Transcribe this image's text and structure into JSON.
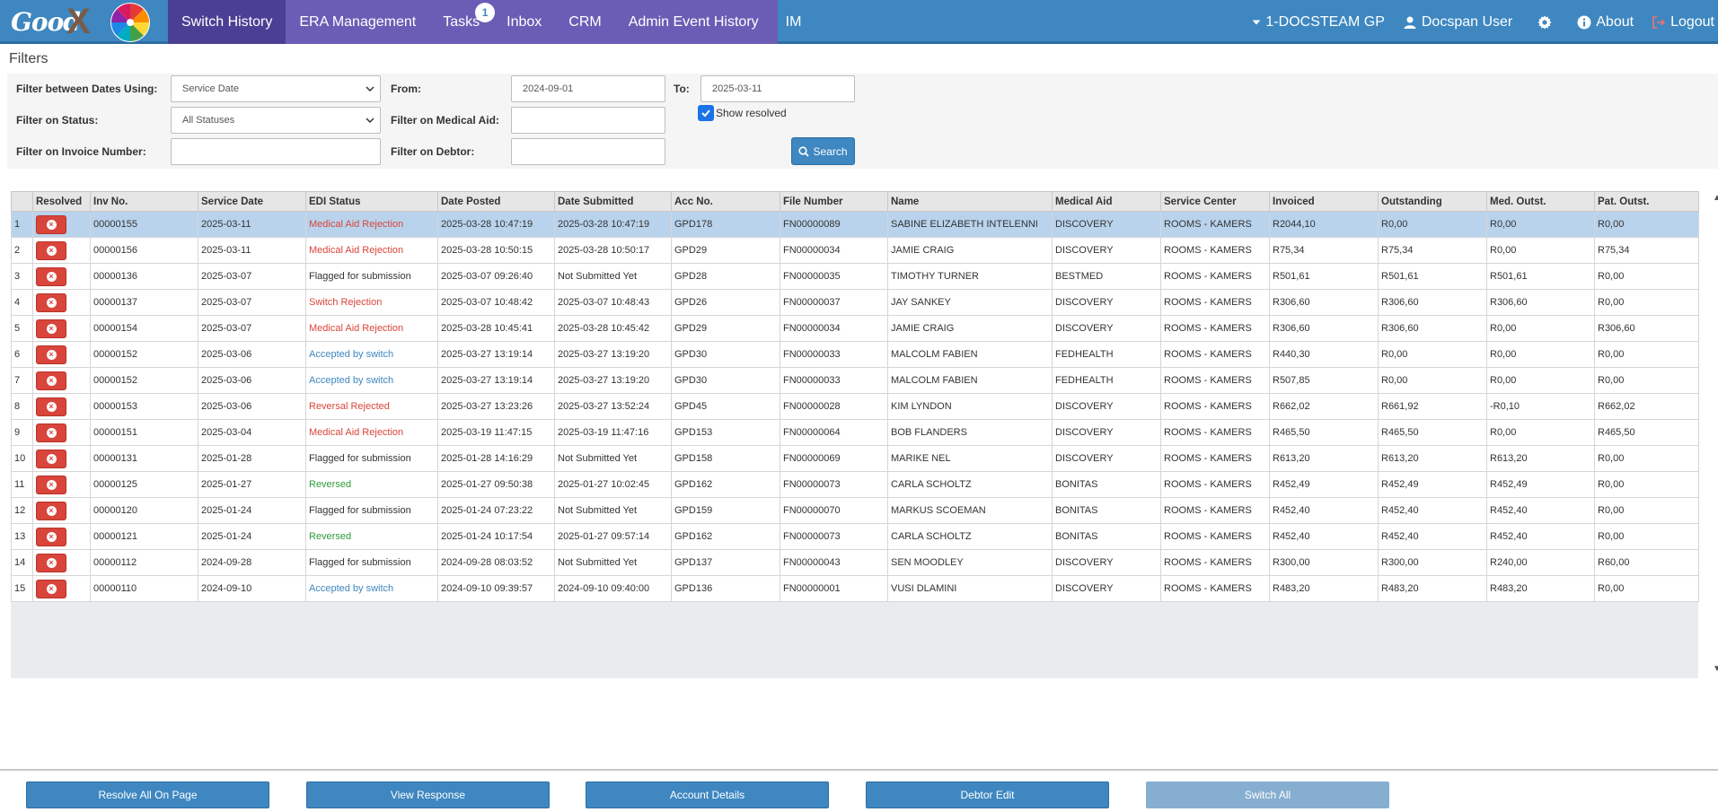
{
  "app": {
    "logo_text": "Good",
    "logo_x": "X"
  },
  "nav": {
    "items": [
      {
        "label": "Switch History",
        "active": true
      },
      {
        "label": "ERA Management"
      },
      {
        "label": "Tasks",
        "badge": "1"
      },
      {
        "label": "Inbox"
      },
      {
        "label": "CRM"
      },
      {
        "label": "Admin Event History"
      },
      {
        "label": "IM"
      }
    ],
    "right": {
      "practice": "1-DOCSTEAM GP",
      "user": "Docspan User",
      "about": "About",
      "logout": "Logout"
    }
  },
  "filters": {
    "title": "Filters",
    "dates_label": "Filter between Dates Using:",
    "dates_value": "Service Date",
    "from_label": "From:",
    "from_value": "2024-09-01",
    "to_label": "To:",
    "to_value": "2025-03-11",
    "status_label": "Filter on Status:",
    "status_value": "All Statuses",
    "medaid_label": "Filter on Medical Aid:",
    "medaid_value": "",
    "show_resolved_label": "Show resolved",
    "show_resolved": true,
    "invoice_label": "Filter on Invoice Number:",
    "invoice_value": "",
    "debtor_label": "Filter on Debtor:",
    "debtor_value": "",
    "search_label": "Search"
  },
  "table": {
    "columns": [
      "",
      "Resolved",
      "Inv No.",
      "Service Date",
      "EDI Status",
      "Date Posted",
      "Date Submitted",
      "Acc No.",
      "File Number",
      "Name",
      "Medical Aid",
      "Service Center",
      "Invoiced",
      "Outstanding",
      "Med. Outst.",
      "Pat. Outst."
    ],
    "rows": [
      {
        "n": "1",
        "inv": "00000155",
        "sdate": "2025-03-11",
        "status": "Medical Aid Rejection",
        "stype": "red",
        "posted": "2025-03-28 10:47:19",
        "submitted": "2025-03-28 10:47:19",
        "acc": "GPD178",
        "file": "FN00000089",
        "name": "SABINE ELIZABETH INTELENNI",
        "medaid": "DISCOVERY",
        "center": "ROOMS - KAMERS",
        "invoiced": "R2044,10",
        "outstanding": "R0,00",
        "med": "R0,00",
        "pat": "R0,00",
        "selected": true
      },
      {
        "n": "2",
        "inv": "00000156",
        "sdate": "2025-03-11",
        "status": "Medical Aid Rejection",
        "stype": "red",
        "posted": "2025-03-28 10:50:15",
        "submitted": "2025-03-28 10:50:17",
        "acc": "GPD29",
        "file": "FN00000034",
        "name": "JAMIE CRAIG",
        "medaid": "DISCOVERY",
        "center": "ROOMS - KAMERS",
        "invoiced": "R75,34",
        "outstanding": "R75,34",
        "med": "R0,00",
        "pat": "R75,34"
      },
      {
        "n": "3",
        "inv": "00000136",
        "sdate": "2025-03-07",
        "status": "Flagged for submission",
        "stype": "normal",
        "posted": "2025-03-07 09:26:40",
        "submitted": "Not Submitted Yet",
        "acc": "GPD28",
        "file": "FN00000035",
        "name": "TIMOTHY TURNER",
        "medaid": "BESTMED",
        "center": "ROOMS - KAMERS",
        "invoiced": "R501,61",
        "outstanding": "R501,61",
        "med": "R501,61",
        "pat": "R0,00"
      },
      {
        "n": "4",
        "inv": "00000137",
        "sdate": "2025-03-07",
        "status": "Switch Rejection",
        "stype": "red",
        "posted": "2025-03-07 10:48:42",
        "submitted": "2025-03-07 10:48:43",
        "acc": "GPD26",
        "file": "FN00000037",
        "name": "JAY SANKEY",
        "medaid": "DISCOVERY",
        "center": "ROOMS - KAMERS",
        "invoiced": "R306,60",
        "outstanding": "R306,60",
        "med": "R306,60",
        "pat": "R0,00"
      },
      {
        "n": "5",
        "inv": "00000154",
        "sdate": "2025-03-07",
        "status": "Medical Aid Rejection",
        "stype": "red",
        "posted": "2025-03-28 10:45:41",
        "submitted": "2025-03-28 10:45:42",
        "acc": "GPD29",
        "file": "FN00000034",
        "name": "JAMIE CRAIG",
        "medaid": "DISCOVERY",
        "center": "ROOMS - KAMERS",
        "invoiced": "R306,60",
        "outstanding": "R306,60",
        "med": "R0,00",
        "pat": "R306,60"
      },
      {
        "n": "6",
        "inv": "00000152",
        "sdate": "2025-03-06",
        "status": "Accepted by switch",
        "stype": "blue",
        "posted": "2025-03-27 13:19:14",
        "submitted": "2025-03-27 13:19:20",
        "acc": "GPD30",
        "file": "FN00000033",
        "name": "MALCOLM FABIEN",
        "medaid": "FEDHEALTH",
        "center": "ROOMS - KAMERS",
        "invoiced": "R440,30",
        "outstanding": "R0,00",
        "med": "R0,00",
        "pat": "R0,00"
      },
      {
        "n": "7",
        "inv": "00000152",
        "sdate": "2025-03-06",
        "status": "Accepted by switch",
        "stype": "blue",
        "posted": "2025-03-27 13:19:14",
        "submitted": "2025-03-27 13:19:20",
        "acc": "GPD30",
        "file": "FN00000033",
        "name": "MALCOLM FABIEN",
        "medaid": "FEDHEALTH",
        "center": "ROOMS - KAMERS",
        "invoiced": "R507,85",
        "outstanding": "R0,00",
        "med": "R0,00",
        "pat": "R0,00"
      },
      {
        "n": "8",
        "inv": "00000153",
        "sdate": "2025-03-06",
        "status": "Reversal Rejected",
        "stype": "red",
        "posted": "2025-03-27 13:23:26",
        "submitted": "2025-03-27 13:52:24",
        "acc": "GPD45",
        "file": "FN00000028",
        "name": "KIM LYNDON",
        "medaid": "DISCOVERY",
        "center": "ROOMS - KAMERS",
        "invoiced": "R662,02",
        "outstanding": "R661,92",
        "med": "-R0,10",
        "pat": "R662,02"
      },
      {
        "n": "9",
        "inv": "00000151",
        "sdate": "2025-03-04",
        "status": "Medical Aid Rejection",
        "stype": "red",
        "posted": "2025-03-19 11:47:15",
        "submitted": "2025-03-19 11:47:16",
        "acc": "GPD153",
        "file": "FN00000064",
        "name": "BOB FLANDERS",
        "medaid": "DISCOVERY",
        "center": "ROOMS - KAMERS",
        "invoiced": "R465,50",
        "outstanding": "R465,50",
        "med": "R0,00",
        "pat": "R465,50"
      },
      {
        "n": "10",
        "inv": "00000131",
        "sdate": "2025-01-28",
        "status": "Flagged for submission",
        "stype": "normal",
        "posted": "2025-01-28 14:16:29",
        "submitted": "Not Submitted Yet",
        "acc": "GPD158",
        "file": "FN00000069",
        "name": "MARIKE NEL",
        "medaid": "DISCOVERY",
        "center": "ROOMS - KAMERS",
        "invoiced": "R613,20",
        "outstanding": "R613,20",
        "med": "R613,20",
        "pat": "R0,00"
      },
      {
        "n": "11",
        "inv": "00000125",
        "sdate": "2025-01-27",
        "status": "Reversed",
        "stype": "green",
        "posted": "2025-01-27 09:50:38",
        "submitted": "2025-01-27 10:02:45",
        "acc": "GPD162",
        "file": "FN00000073",
        "name": "CARLA SCHOLTZ",
        "medaid": "BONITAS",
        "center": "ROOMS - KAMERS",
        "invoiced": "R452,49",
        "outstanding": "R452,49",
        "med": "R452,49",
        "pat": "R0,00"
      },
      {
        "n": "12",
        "inv": "00000120",
        "sdate": "2025-01-24",
        "status": "Flagged for submission",
        "stype": "normal",
        "posted": "2025-01-24 07:23:22",
        "submitted": "Not Submitted Yet",
        "acc": "GPD159",
        "file": "FN00000070",
        "name": "MARKUS SCOEMAN",
        "medaid": "BONITAS",
        "center": "ROOMS - KAMERS",
        "invoiced": "R452,40",
        "outstanding": "R452,40",
        "med": "R452,40",
        "pat": "R0,00"
      },
      {
        "n": "13",
        "inv": "00000121",
        "sdate": "2025-01-24",
        "status": "Reversed",
        "stype": "green",
        "posted": "2025-01-24 10:17:54",
        "submitted": "2025-01-27 09:57:14",
        "acc": "GPD162",
        "file": "FN00000073",
        "name": "CARLA SCHOLTZ",
        "medaid": "BONITAS",
        "center": "ROOMS - KAMERS",
        "invoiced": "R452,40",
        "outstanding": "R452,40",
        "med": "R452,40",
        "pat": "R0,00"
      },
      {
        "n": "14",
        "inv": "00000112",
        "sdate": "2024-09-28",
        "status": "Flagged for submission",
        "stype": "normal",
        "posted": "2024-09-28 08:03:52",
        "submitted": "Not Submitted Yet",
        "acc": "GPD137",
        "file": "FN00000043",
        "name": "SEN MOODLEY",
        "medaid": "DISCOVERY",
        "center": "ROOMS - KAMERS",
        "invoiced": "R300,00",
        "outstanding": "R300,00",
        "med": "R240,00",
        "pat": "R60,00"
      },
      {
        "n": "15",
        "inv": "00000110",
        "sdate": "2024-09-10",
        "status": "Accepted by switch",
        "stype": "blue",
        "posted": "2024-09-10 09:39:57",
        "submitted": "2024-09-10 09:40:00",
        "acc": "GPD136",
        "file": "FN00000001",
        "name": "VUSI DLAMINI",
        "medaid": "DISCOVERY",
        "center": "ROOMS - KAMERS",
        "invoiced": "R483,20",
        "outstanding": "R483,20",
        "med": "R483,20",
        "pat": "R0,00"
      }
    ]
  },
  "footer": {
    "buttons": [
      {
        "label": "Resolve All On Page"
      },
      {
        "label": "View Response"
      },
      {
        "label": "Account Details"
      },
      {
        "label": "Debtor Edit"
      },
      {
        "label": "Switch All",
        "disabled": true
      }
    ]
  }
}
